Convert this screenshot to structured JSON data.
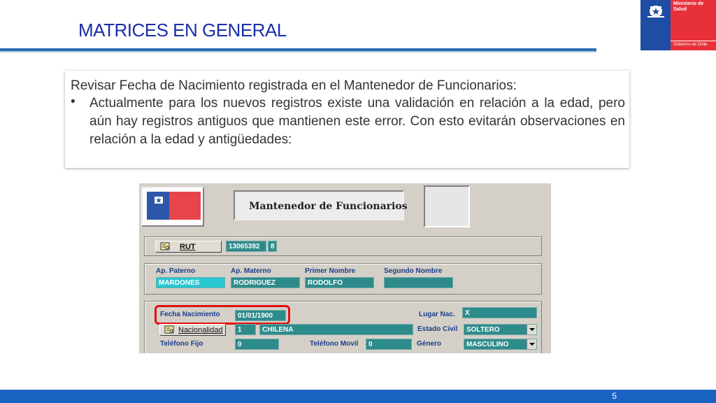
{
  "slide": {
    "title": "MATRICES EN GENERAL",
    "page_number": "5",
    "logo": {
      "ministry": "Ministerio de Salud",
      "government": "Gobierno de Chile"
    }
  },
  "callout": {
    "heading": "Revisar Fecha de Nacimiento registrada en el Mantenedor de Funcionarios:",
    "bullet": "•",
    "body": "Actualmente para los nuevos registros existe una validación en relación a la edad, pero aún hay registros antiguos que mantienen este error. Con esto evitarán observaciones en relación a la edad y antigüedades:"
  },
  "app": {
    "window_title": "Mantenedor de Funcionarios",
    "rut": {
      "button_label": "RUT",
      "number": "13065392",
      "check_digit": "8"
    },
    "names": {
      "paterno_label": "Ap. Paterno",
      "materno_label": "Ap. Materno",
      "nombre_label": "Primer Nombre",
      "segundo_label": "Segundo Nombre",
      "paterno_value": "MARDONES",
      "materno_value": "RODRIGUEZ",
      "nombre_value": "RODOLFO",
      "segundo_value": ""
    },
    "details": {
      "fecha_label": "Fecha Nacimiento",
      "fecha_value": "01/01/1900",
      "lugar_label": "Lugar Nac.",
      "lugar_value": "X",
      "nacionalidad_button": "Nacionalidad",
      "nacionalidad_code": "1",
      "nacionalidad_value": "CHILENA",
      "estado_label": "Estado Civil",
      "estado_value": "SOLTERO",
      "telfijo_label": "Teléfono Fijo",
      "telfijo_value": "0",
      "telmovil_label": "Teléfono Movil",
      "telmovil_value": "0",
      "genero_label": "Género",
      "genero_value": "MASCULINO"
    }
  },
  "colors": {
    "title_blue": "#1a2ea8",
    "rule_blue": "#2a6fb5",
    "footer_blue": "#1a62c2",
    "field_teal": "#2e8b8b",
    "highlight_red": "#e01010"
  }
}
